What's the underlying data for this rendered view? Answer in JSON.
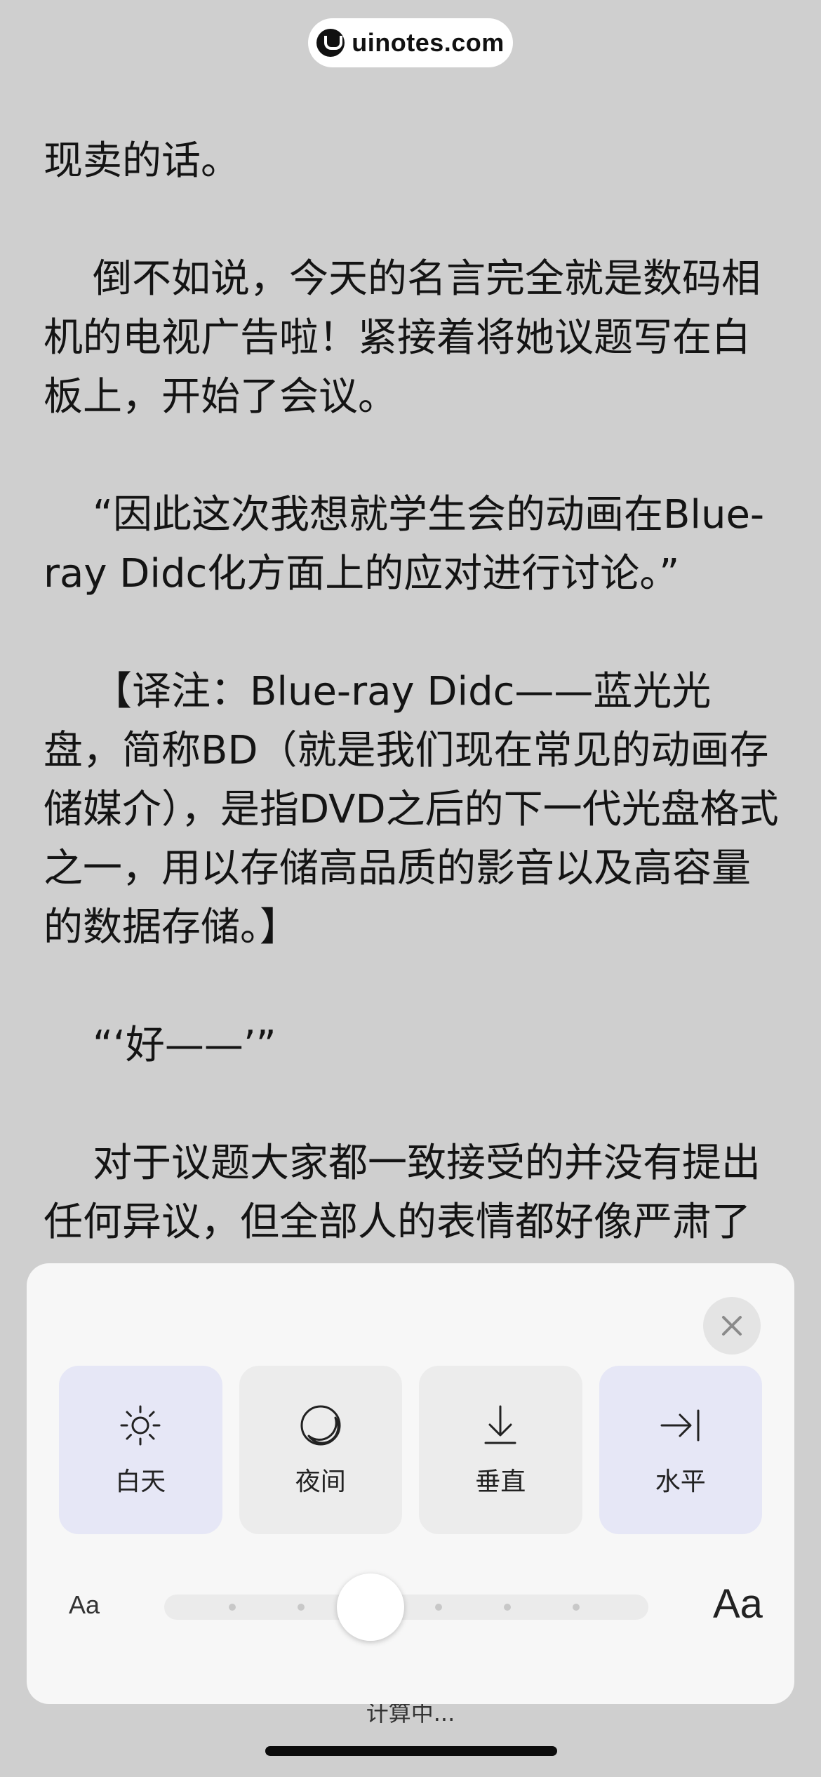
{
  "brand": {
    "text": "uinotes.com"
  },
  "reader": {
    "paragraphs": [
      "现卖的话。",
      "倒不如说，今天的名言完全就是数码相机的电视广告啦！紧接着将她议题写在白板上，开始了会议。",
      "“因此这次我想就学生会的动画在Blue-ray Didc化方面上的应对进行讨论。”",
      "【译注：Blue-ray Didc——蓝光光盘，简称BD（就是我们现在常见的动画存储媒介），是指DVD之后的下一代光盘格式之一，用以存储高品质的影音以及高容量的数据存储。】",
      "“‘好——’”",
      "对于议题大家都一致接受的并没有提出任何异议，但全部人的表情都好像严肃了"
    ]
  },
  "settings": {
    "modes": [
      {
        "label": "白天",
        "icon": "sun-icon",
        "active": true
      },
      {
        "label": "夜间",
        "icon": "moon-icon",
        "active": false
      },
      {
        "label": "垂直",
        "icon": "arrow-down-icon",
        "active": false
      },
      {
        "label": "水平",
        "icon": "arrow-right-bar-icon",
        "active": true
      }
    ],
    "font_small_label": "Aa",
    "font_large_label": "Aa",
    "font_size_step": 3,
    "font_size_steps_total": 7
  },
  "status": {
    "text": "计算中..."
  },
  "colors": {
    "background": "#cfcfcf",
    "sheet": "#f7f7f7",
    "active_mode": "#e6e7f6",
    "inactive_mode": "#ececec"
  }
}
